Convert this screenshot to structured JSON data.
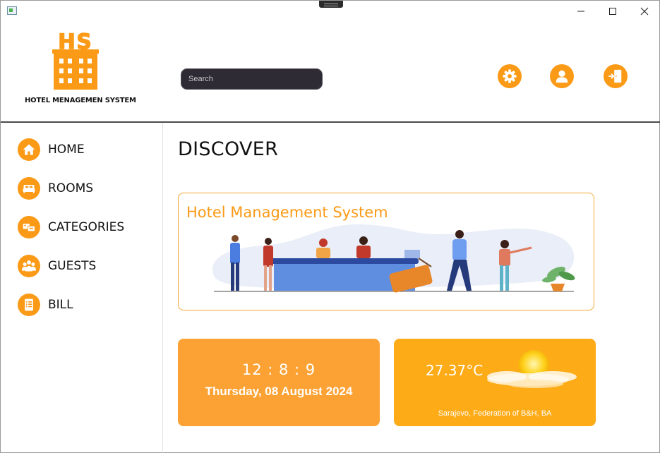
{
  "app": {
    "logo_letters": "HS",
    "logo_caption": "HOTEL MENAGEMEN SYSTEM"
  },
  "header": {
    "search": {
      "placeholder": "Search",
      "value": ""
    },
    "icons": [
      "settings-gear-icon",
      "user-profile-icon",
      "logout-door-icon"
    ]
  },
  "sidebar": {
    "items": [
      {
        "label": "HOME",
        "icon": "home-icon"
      },
      {
        "label": "ROOMS",
        "icon": "bed-icon"
      },
      {
        "label": "CATEGORIES",
        "icon": "categories-icon"
      },
      {
        "label": "GUESTS",
        "icon": "guests-icon"
      },
      {
        "label": "BILL",
        "icon": "bill-icon"
      }
    ]
  },
  "main": {
    "title": "DISCOVER",
    "banner": {
      "title": "Hotel Management System"
    },
    "clock": {
      "time": "12 : 8 : 9",
      "date": "Thursday, 08 August 2024"
    },
    "weather": {
      "temperature": "27.37°C",
      "location": "Sarajevo,  Federation of B&H,  BA",
      "icon": "sun-cloud-icon"
    }
  },
  "colors": {
    "accent": "#fb9a16",
    "card_time": "#fca234",
    "card_weather": "#fdab17",
    "search_bg": "#2e2b35"
  }
}
